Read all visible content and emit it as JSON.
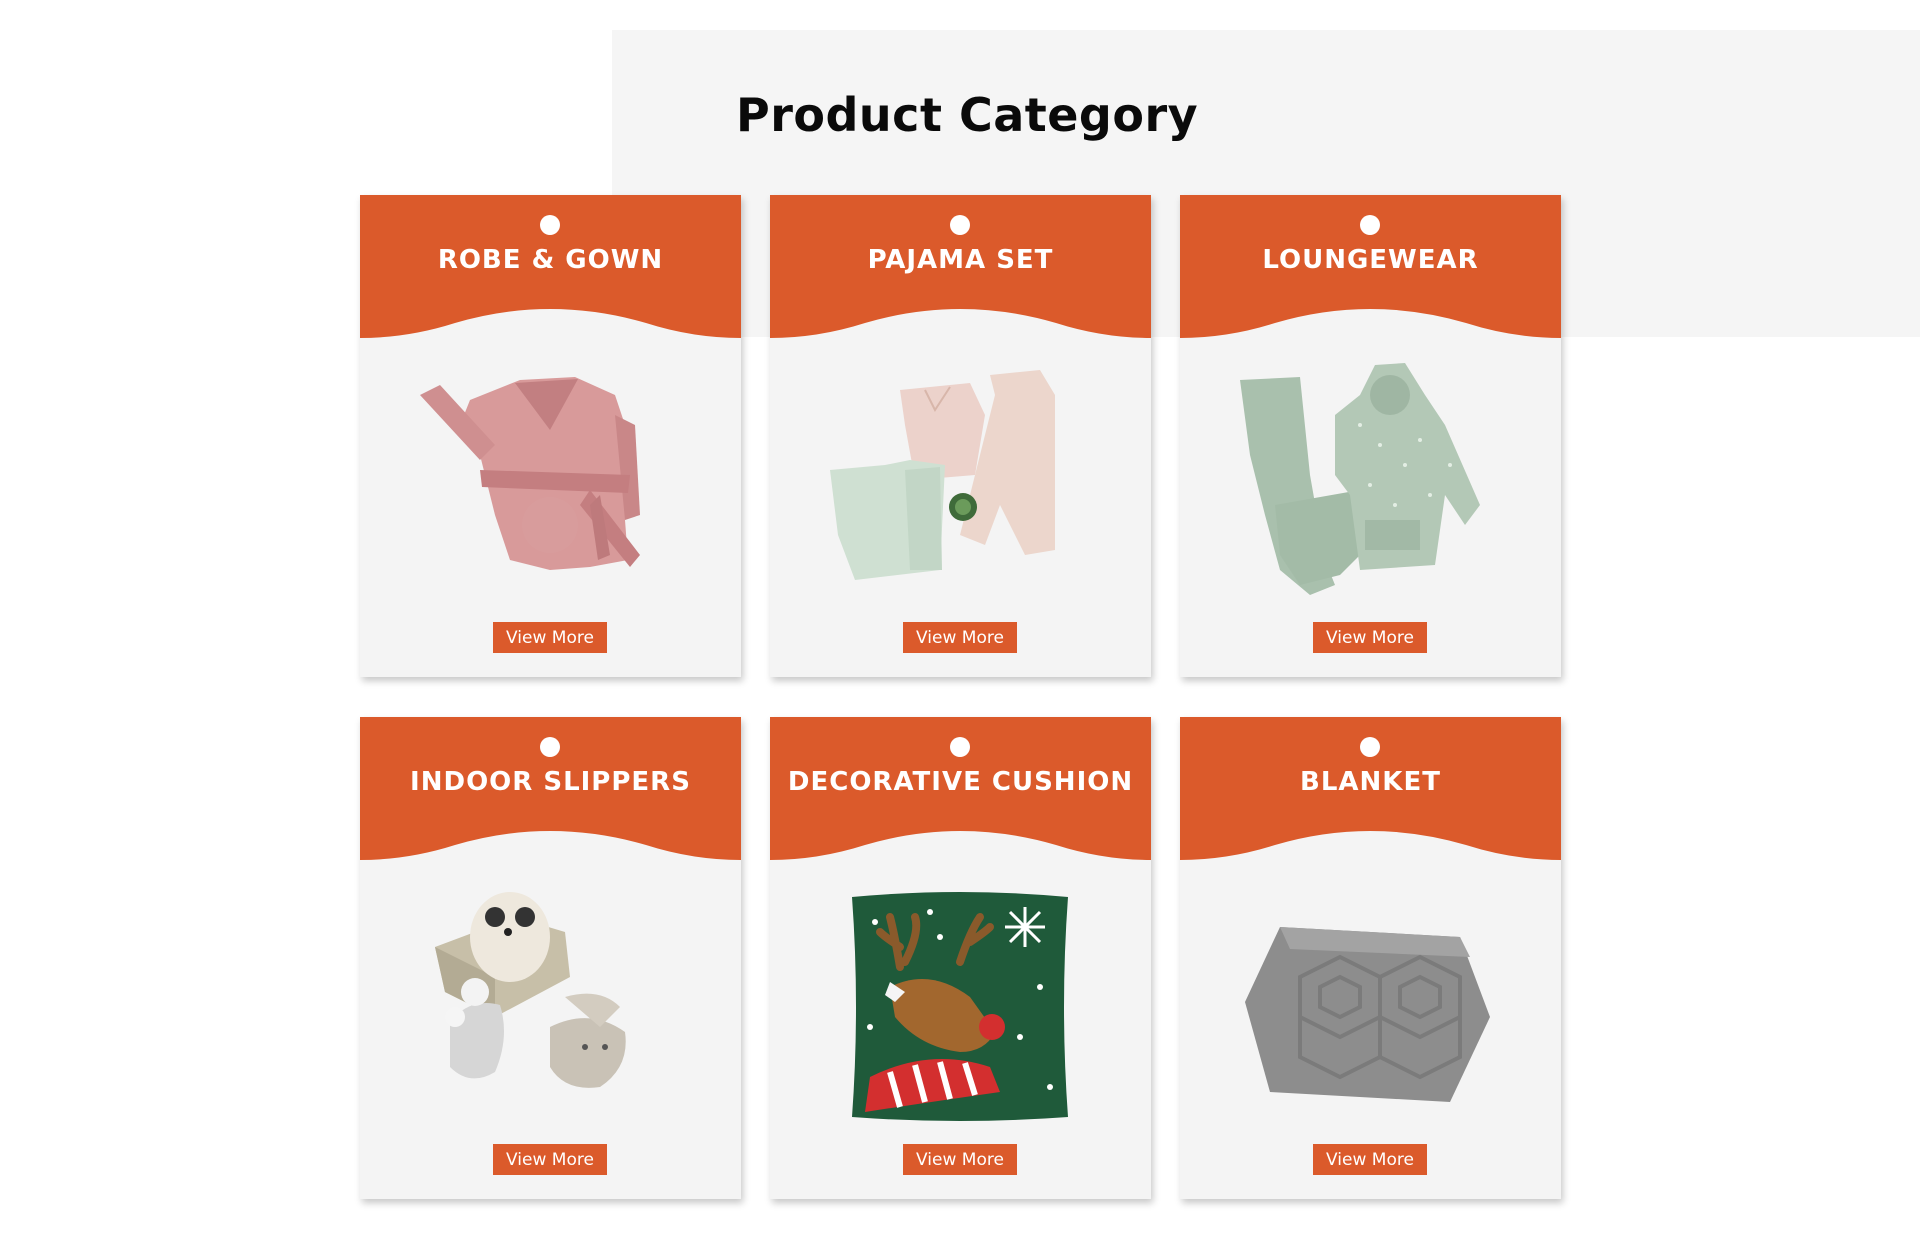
{
  "section": {
    "title": "Product Category"
  },
  "colors": {
    "accent": "#db5a2b",
    "panel_bg": "#f5f5f5",
    "card_bg": "#f4f4f4"
  },
  "categories": [
    {
      "title": "ROBE & GOWN",
      "button": "View More",
      "image": "pink-robe"
    },
    {
      "title": "PAJAMA SET",
      "button": "View More",
      "image": "pajama-sets"
    },
    {
      "title": "LOUNGEWEAR",
      "button": "View More",
      "image": "sage-hoodie-set"
    },
    {
      "title": "INDOOR SLIPPERS",
      "button": "View More",
      "image": "plush-slippers"
    },
    {
      "title": "DECORATIVE CUSHION",
      "button": "View More",
      "image": "reindeer-cushion"
    },
    {
      "title": "BLANKET",
      "button": "View More",
      "image": "grey-blanket"
    }
  ]
}
